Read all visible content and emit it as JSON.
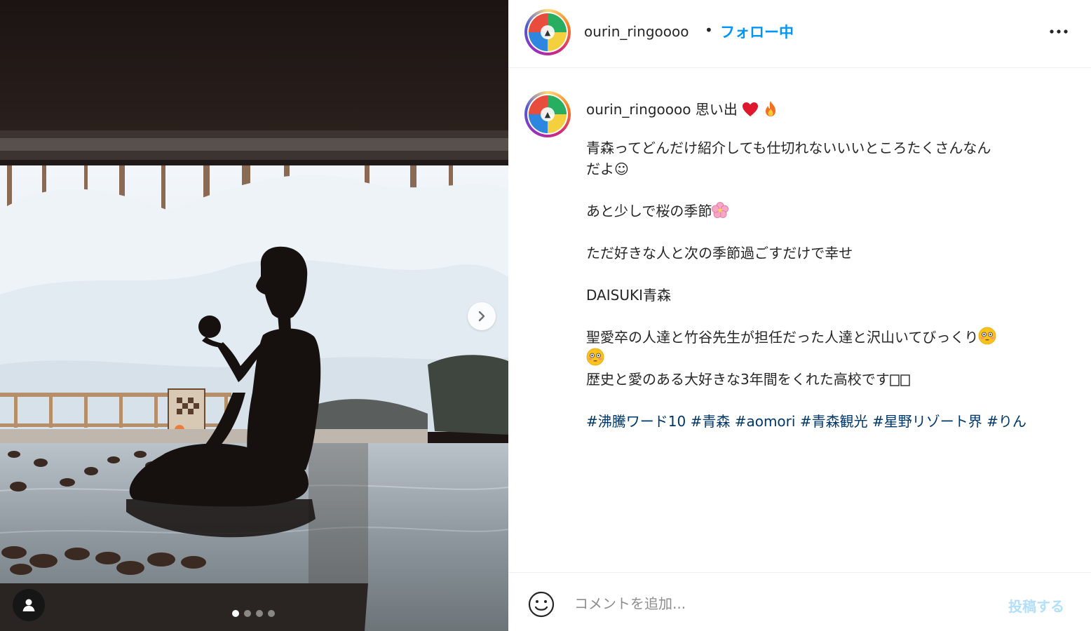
{
  "post": {
    "username": "ourin_ringoooo",
    "separator": "•",
    "follow_state": "フォロー中",
    "more_icon": "more-horizontal-icon"
  },
  "media": {
    "slide_count": 4,
    "active_slide": 1,
    "next_icon": "chevron-right-icon",
    "tag_icon": "user-tag-icon"
  },
  "caption": {
    "username": "ourin_ringoooo",
    "head_text": "思い出",
    "head_emojis": [
      "heart",
      "fire"
    ],
    "lines": [
      "青森ってどんだけ紹介しても仕切れないいいところたくさんなん",
      "だよ☺",
      "",
      "あと少しで桜の季節",
      "",
      "ただ好きな人と次の季節過ごすだけで幸せ",
      "",
      "DAISUKI青森",
      "",
      "聖愛卒の人達と竹谷先生が担任だった人達と沢山いてびっくり",
      "",
      "歴史と愛のある大好きな3年間をくれた高校です"
    ],
    "hashtags": [
      "#沸騰ワード10",
      "#青森",
      "#aomori",
      "#青森観光",
      "#星野リゾート界",
      "#りん"
    ]
  },
  "comment": {
    "placeholder": "コメントを追加...",
    "post_label": "投稿する",
    "emoji_icon": "smiley-icon"
  },
  "colors": {
    "link": "#0095f6",
    "hashtag": "#00376b",
    "post_disabled": "#b2dffc",
    "text": "#262626",
    "muted": "#8e8e8e"
  }
}
